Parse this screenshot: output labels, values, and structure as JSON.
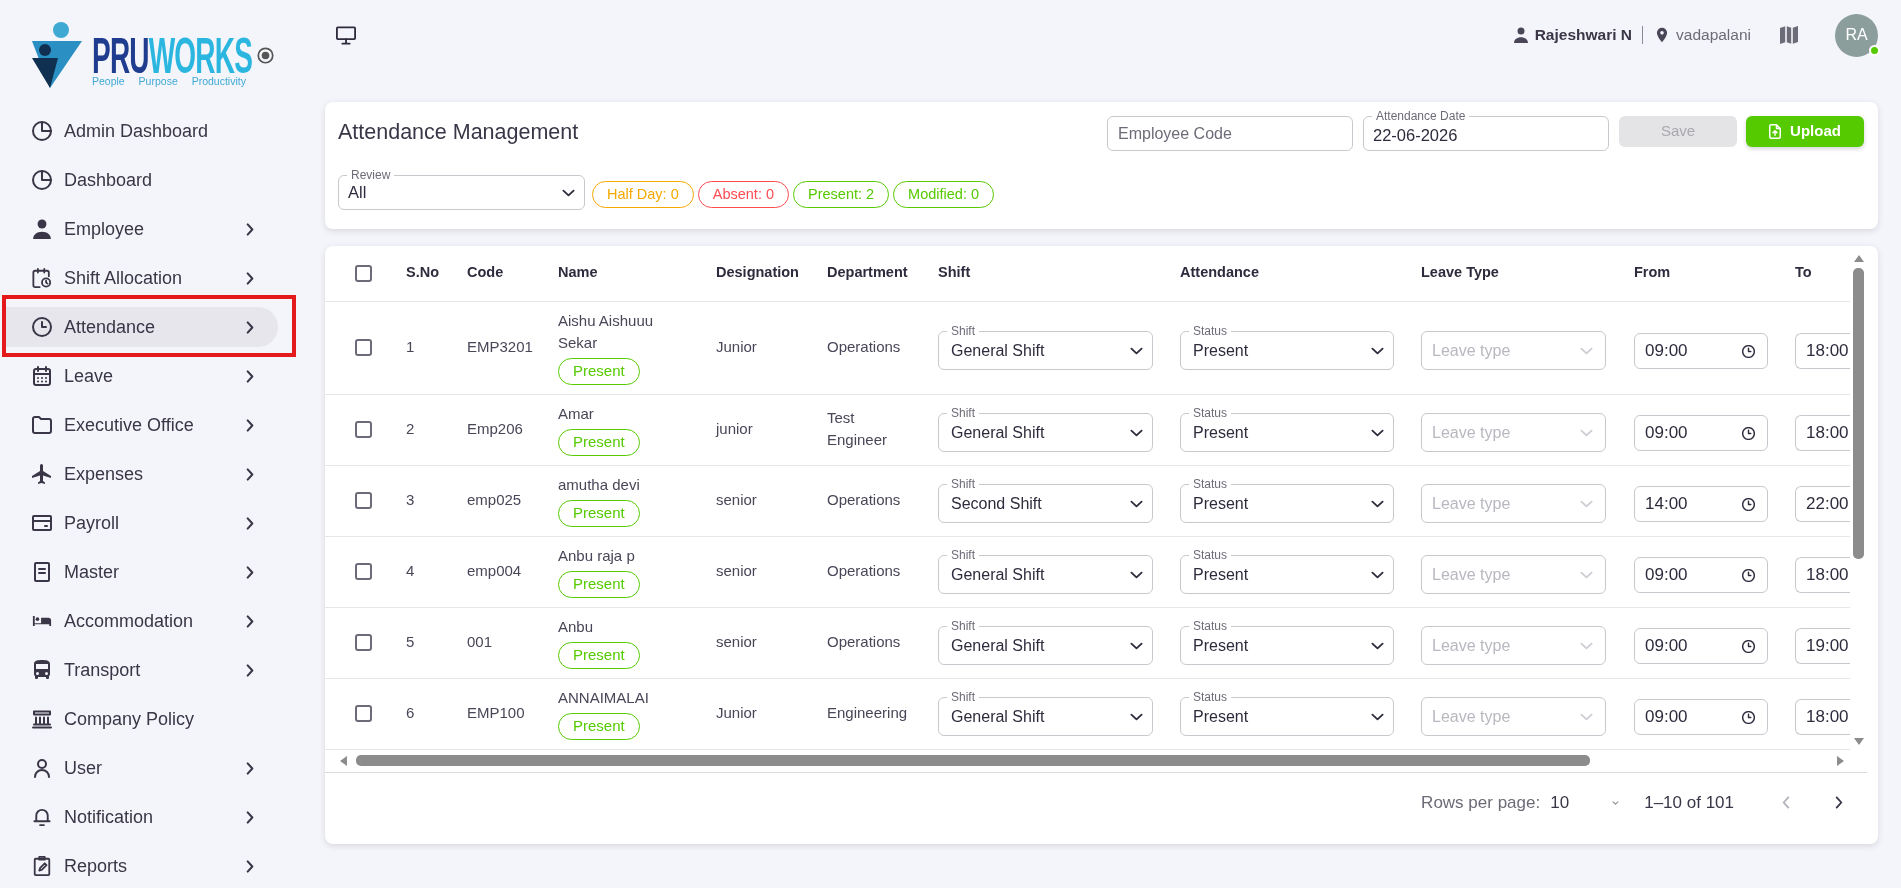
{
  "logo": {
    "wordmark": [
      {
        "text": "PRU",
        "color": "#1f3c8f"
      },
      {
        "text": "WORKS",
        "color": "#2bb6e0"
      }
    ],
    "tagline": "People Purpose Productivity"
  },
  "sidebar": {
    "items": [
      {
        "label": "Admin Dashboard",
        "expandable": false,
        "selected": false,
        "highlighted": false
      },
      {
        "label": "Dashboard",
        "expandable": false,
        "selected": false,
        "highlighted": false
      },
      {
        "label": "Employee",
        "expandable": true,
        "selected": false,
        "highlighted": false
      },
      {
        "label": "Shift Allocation",
        "expandable": true,
        "selected": false,
        "highlighted": false
      },
      {
        "label": "Attendance",
        "expandable": true,
        "selected": true,
        "highlighted": true
      },
      {
        "label": "Leave",
        "expandable": true,
        "selected": false,
        "highlighted": false
      },
      {
        "label": "Executive Office",
        "expandable": true,
        "selected": false,
        "highlighted": false
      },
      {
        "label": "Expenses",
        "expandable": true,
        "selected": false,
        "highlighted": false
      },
      {
        "label": "Payroll",
        "expandable": true,
        "selected": false,
        "highlighted": false
      },
      {
        "label": "Master",
        "expandable": true,
        "selected": false,
        "highlighted": false
      },
      {
        "label": "Accommodation",
        "expandable": true,
        "selected": false,
        "highlighted": false
      },
      {
        "label": "Transport",
        "expandable": true,
        "selected": false,
        "highlighted": false
      },
      {
        "label": "Company Policy",
        "expandable": false,
        "selected": false,
        "highlighted": false
      },
      {
        "label": "User",
        "expandable": true,
        "selected": false,
        "highlighted": false
      },
      {
        "label": "Notification",
        "expandable": true,
        "selected": false,
        "highlighted": false
      },
      {
        "label": "Reports",
        "expandable": true,
        "selected": false,
        "highlighted": false
      }
    ]
  },
  "header": {
    "user_name": "Rajeshwari N",
    "location": "vadapalani",
    "avatar_initials": "RA",
    "online": true
  },
  "toolbar": {
    "title": "Attendance Management",
    "employee_code": {
      "placeholder": "Employee Code"
    },
    "attendance_date": {
      "label": "Attendance Date",
      "value": "22-06-2026"
    },
    "buttons": [
      {
        "label": "Save",
        "kind": "save",
        "disabled": true
      },
      {
        "label": "Upload",
        "kind": "upload",
        "disabled": false
      }
    ],
    "review": {
      "label": "Review",
      "value": "All"
    },
    "summary": [
      {
        "label": "Half Day: 0",
        "color": "#f5a800"
      },
      {
        "label": "Absent: 0",
        "color": "#ff4c51"
      },
      {
        "label": "Present: 2",
        "color": "#56ca00"
      },
      {
        "label": "Modified: 0",
        "color": "#56ca00"
      }
    ]
  },
  "table": {
    "select_all": false,
    "columns": [
      "S.No",
      "Code",
      "Name",
      "Designation",
      "Department",
      "Shift",
      "Attendance",
      "Leave Type",
      "From",
      "To"
    ],
    "rows": [
      {
        "checked": false,
        "sno": "1",
        "code": "EMP3201",
        "name": "Aishu Aishuuu Sekar",
        "attendance_badge": "Present",
        "designation": "Junior",
        "department": "Operations",
        "shift": {
          "label": "Shift",
          "value": "General Shift"
        },
        "status": {
          "label": "Status",
          "value": "Present"
        },
        "leave_type": {
          "placeholder": "Leave type"
        },
        "from": "09:00",
        "to": "18:00"
      },
      {
        "checked": false,
        "sno": "2",
        "code": "Emp206",
        "name": "Amar",
        "attendance_badge": "Present",
        "designation": "junior",
        "department": "Test Engineer",
        "shift": {
          "label": "Shift",
          "value": "General Shift"
        },
        "status": {
          "label": "Status",
          "value": "Present"
        },
        "leave_type": {
          "placeholder": "Leave type"
        },
        "from": "09:00",
        "to": "18:00"
      },
      {
        "checked": false,
        "sno": "3",
        "code": "emp025",
        "name": "amutha devi",
        "attendance_badge": "Present",
        "designation": "senior",
        "department": "Operations",
        "shift": {
          "label": "Shift",
          "value": "Second Shift"
        },
        "status": {
          "label": "Status",
          "value": "Present"
        },
        "leave_type": {
          "placeholder": "Leave type"
        },
        "from": "14:00",
        "to": "22:00"
      },
      {
        "checked": false,
        "sno": "4",
        "code": "emp004",
        "name": "Anbu raja p",
        "attendance_badge": "Present",
        "designation": "senior",
        "department": "Operations",
        "shift": {
          "label": "Shift",
          "value": "General Shift"
        },
        "status": {
          "label": "Status",
          "value": "Present"
        },
        "leave_type": {
          "placeholder": "Leave type"
        },
        "from": "09:00",
        "to": "18:00"
      },
      {
        "checked": false,
        "sno": "5",
        "code": "001",
        "name": "Anbu",
        "attendance_badge": "Present",
        "designation": "senior",
        "department": "Operations",
        "shift": {
          "label": "Shift",
          "value": "General Shift"
        },
        "status": {
          "label": "Status",
          "value": "Present"
        },
        "leave_type": {
          "placeholder": "Leave type"
        },
        "from": "09:00",
        "to": "19:00"
      },
      {
        "checked": false,
        "sno": "6",
        "code": "EMP100",
        "name": "ANNAIMALAI",
        "attendance_badge": "Present",
        "designation": "Junior",
        "department": "Engineering",
        "shift": {
          "label": "Shift",
          "value": "General Shift"
        },
        "status": {
          "label": "Status",
          "value": "Present"
        },
        "leave_type": {
          "placeholder": "Leave type"
        },
        "from": "09:00",
        "to": "18:00"
      }
    ],
    "pagination": {
      "label": "Rows per page:",
      "rows_per_page": "10",
      "range": "1–10 of 101",
      "prev_disabled": true,
      "next_disabled": false
    }
  }
}
